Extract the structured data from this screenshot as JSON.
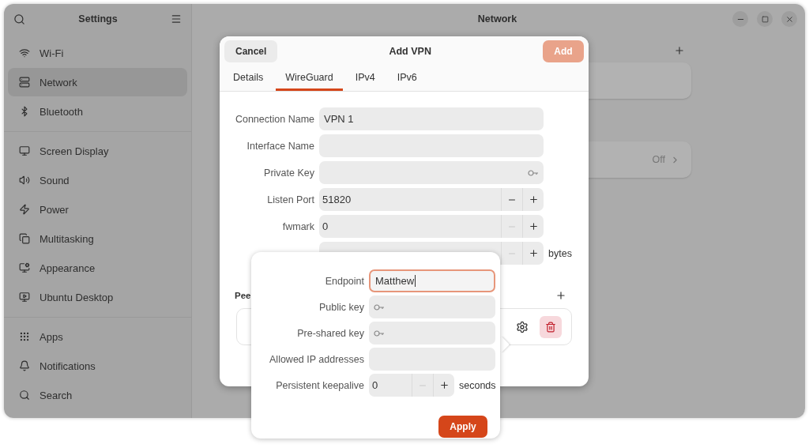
{
  "sidebar": {
    "title": "Settings",
    "groups": [
      [
        {
          "label": "Wi-Fi",
          "selected": false
        },
        {
          "label": "Network",
          "selected": true
        },
        {
          "label": "Bluetooth",
          "selected": false
        }
      ],
      [
        {
          "label": "Screen Display",
          "selected": false
        },
        {
          "label": "Sound",
          "selected": false
        },
        {
          "label": "Power",
          "selected": false
        },
        {
          "label": "Multitasking",
          "selected": false
        },
        {
          "label": "Appearance",
          "selected": false
        },
        {
          "label": "Ubuntu Desktop",
          "selected": false
        }
      ],
      [
        {
          "label": "Apps",
          "selected": false
        },
        {
          "label": "Notifications",
          "selected": false
        },
        {
          "label": "Search",
          "selected": false
        }
      ]
    ]
  },
  "main": {
    "title": "Network",
    "rows": [
      {
        "kind": "blank"
      },
      {
        "kind": "value",
        "value": "Off"
      }
    ]
  },
  "dialog": {
    "title": "Add VPN",
    "cancel": "Cancel",
    "add": {
      "label": "Add",
      "disabled": true
    },
    "tabs": [
      {
        "label": "Details",
        "selected": false
      },
      {
        "label": "WireGuard",
        "selected": true
      },
      {
        "label": "IPv4",
        "selected": false
      },
      {
        "label": "IPv6",
        "selected": false
      }
    ],
    "fields": [
      {
        "kind": "text",
        "label": "Connection Name",
        "value": "VPN 1"
      },
      {
        "kind": "text",
        "label": "Interface Name"
      },
      {
        "kind": "secret",
        "label": "Private Key"
      },
      {
        "kind": "spin",
        "label": "Listen Port",
        "value": "51820",
        "minus_disabled": false
      },
      {
        "kind": "spin",
        "label": "fwmark",
        "value": "0",
        "minus_disabled": true
      },
      {
        "kind": "spin",
        "unit": "bytes",
        "minus_disabled": true
      }
    ],
    "peers": {
      "title": "Pee",
      "rows": [
        {
          "kind": "peer"
        }
      ]
    }
  },
  "popover": {
    "fields": [
      {
        "kind": "text",
        "label": "Endpoint",
        "value": "Matthew",
        "focused": true
      },
      {
        "kind": "secret",
        "label": "Public key",
        "focused": false
      },
      {
        "kind": "secret",
        "label": "Pre-shared key",
        "focused": false
      },
      {
        "kind": "text",
        "label": "Allowed IP addresses",
        "focused": false
      },
      {
        "kind": "spin",
        "label": "Persistent keepalive",
        "value": "0",
        "unit": "seconds",
        "minus_disabled": true,
        "focused": false
      }
    ],
    "apply": "Apply"
  }
}
